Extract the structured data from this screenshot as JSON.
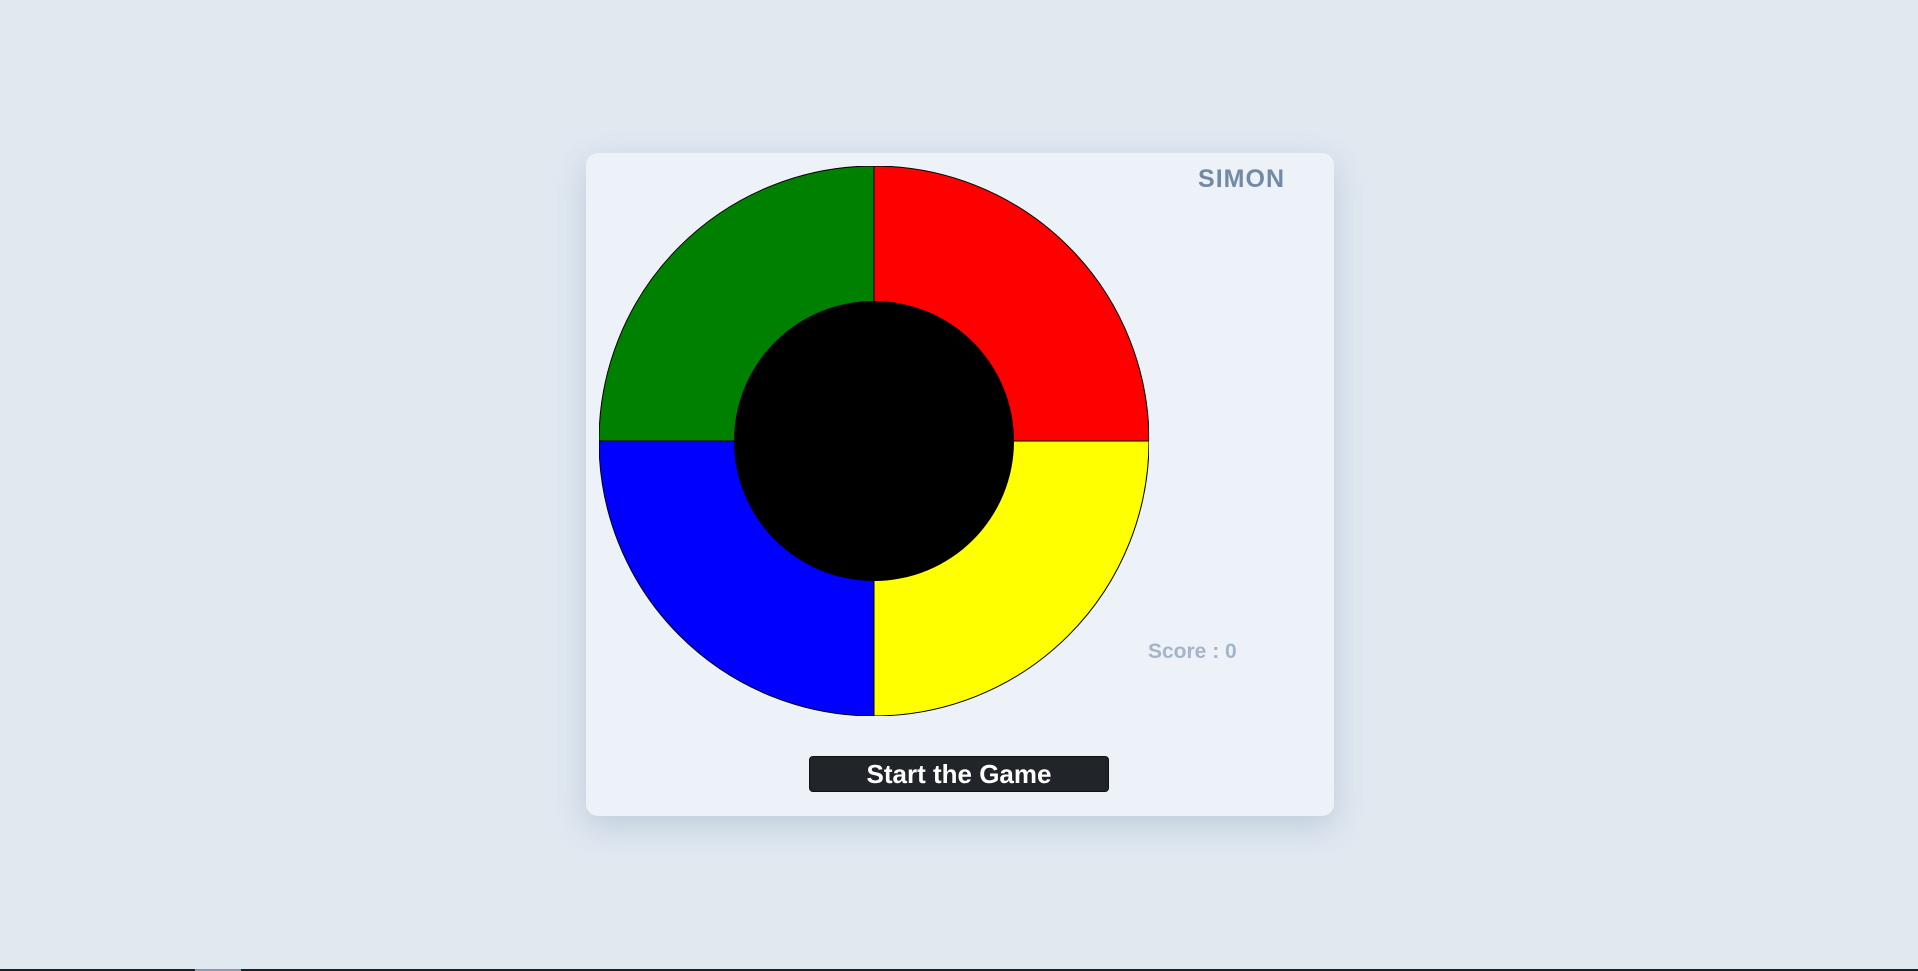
{
  "game": {
    "title": "SIMON",
    "score_text": "Score : 0",
    "start_label": "Start the Game"
  },
  "pads": [
    {
      "name": "green-pad",
      "color": "#008000"
    },
    {
      "name": "red-pad",
      "color": "#ff0000"
    },
    {
      "name": "blue-pad",
      "color": "#0000ff"
    },
    {
      "name": "yellow-pad",
      "color": "#ffff00"
    }
  ],
  "center": {
    "color": "#000000"
  },
  "colors": {
    "background": "#e0e8f0",
    "card": "#ecf2f8",
    "title": "#738aa6",
    "score": "#a4b5ca",
    "button": "#212529"
  }
}
